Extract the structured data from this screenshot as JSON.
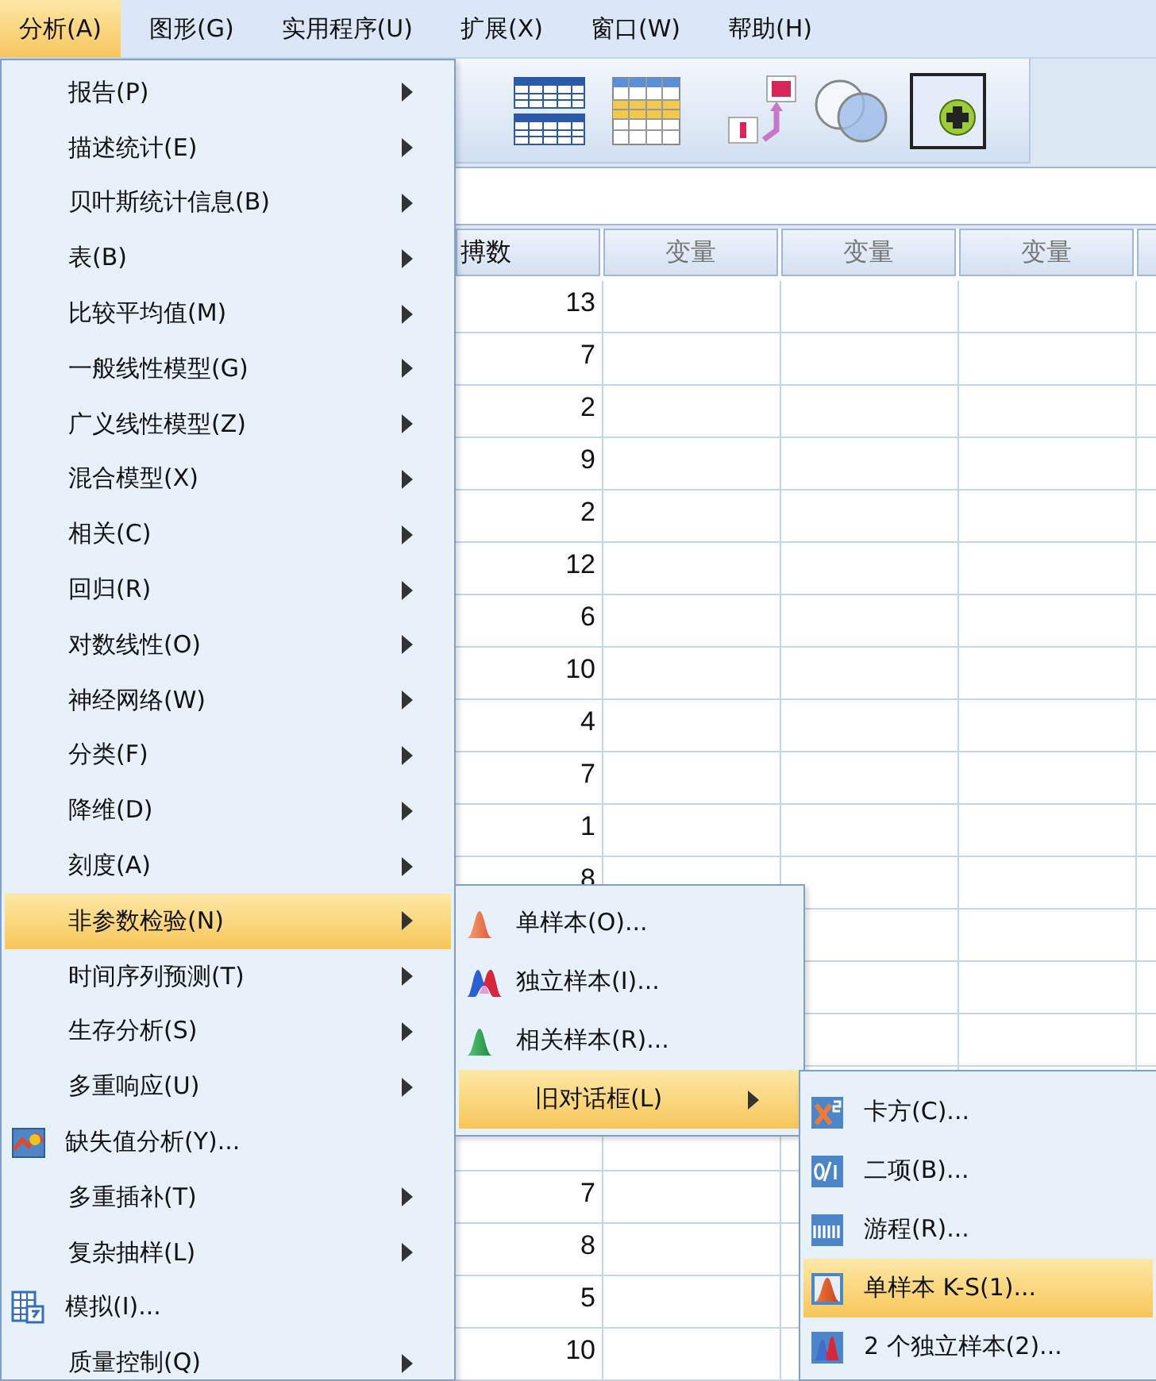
{
  "menubar": [
    {
      "label": "分析(A)",
      "selected": true
    },
    {
      "label": "图形(G)",
      "selected": false
    },
    {
      "label": "实用程序(U)",
      "selected": false
    },
    {
      "label": "扩展(X)",
      "selected": false
    },
    {
      "label": "窗口(W)",
      "selected": false
    },
    {
      "label": "帮助(H)",
      "selected": false
    }
  ],
  "grid": {
    "columns": [
      "搏数",
      "变量",
      "变量",
      "变量"
    ],
    "rows": [
      {
        "value": "13"
      },
      {
        "value": "7"
      },
      {
        "value": "2"
      },
      {
        "value": "9"
      },
      {
        "value": "2"
      },
      {
        "value": "12"
      },
      {
        "value": "6"
      },
      {
        "value": "10"
      },
      {
        "value": "4"
      },
      {
        "value": "7"
      },
      {
        "value": "1"
      },
      {
        "value": "8"
      },
      {},
      {},
      {},
      {},
      {},
      {
        "value": "7"
      },
      {
        "value": "8"
      },
      {
        "value": "5"
      },
      {
        "value": "10"
      }
    ]
  },
  "menu": {
    "items": [
      {
        "label": "报告(P)",
        "kind": "submenu",
        "selected": false
      },
      {
        "label": "描述统计(E)",
        "kind": "submenu",
        "selected": false
      },
      {
        "label": "贝叶斯统计信息(B)",
        "kind": "submenu",
        "selected": false
      },
      {
        "label": "表(B)",
        "kind": "submenu",
        "selected": false
      },
      {
        "label": "比较平均值(M)",
        "kind": "submenu",
        "selected": false
      },
      {
        "label": "一般线性模型(G)",
        "kind": "submenu",
        "selected": false
      },
      {
        "label": "广义线性模型(Z)",
        "kind": "submenu",
        "selected": false
      },
      {
        "label": "混合模型(X)",
        "kind": "submenu",
        "selected": false
      },
      {
        "label": "相关(C)",
        "kind": "submenu",
        "selected": false
      },
      {
        "label": "回归(R)",
        "kind": "submenu",
        "selected": false
      },
      {
        "label": "对数线性(O)",
        "kind": "submenu",
        "selected": false
      },
      {
        "label": "神经网络(W)",
        "kind": "submenu",
        "selected": false
      },
      {
        "label": "分类(F)",
        "kind": "submenu",
        "selected": false
      },
      {
        "label": "降维(D)",
        "kind": "submenu",
        "selected": false
      },
      {
        "label": "刻度(A)",
        "kind": "submenu",
        "selected": false
      },
      {
        "label": "非参数检验(N)",
        "kind": "submenu",
        "selected": true
      },
      {
        "label": "时间序列预测(T)",
        "kind": "submenu",
        "selected": false
      },
      {
        "label": "生存分析(S)",
        "kind": "submenu",
        "selected": false
      },
      {
        "label": "多重响应(U)",
        "kind": "submenu",
        "selected": false
      },
      {
        "label": "缺失值分析(Y)...",
        "kind": "missing",
        "selected": false
      },
      {
        "label": "多重插补(T)",
        "kind": "submenu",
        "selected": false
      },
      {
        "label": "复杂抽样(L)",
        "kind": "submenu",
        "selected": false
      },
      {
        "label": "模拟(I)...",
        "kind": "simulate",
        "selected": false
      },
      {
        "label": "质量控制(Q)",
        "kind": "submenu",
        "selected": false
      }
    ]
  },
  "nonparametric_menu": {
    "items": [
      {
        "label": "单样本(O)...",
        "kind": "one",
        "selected": false
      },
      {
        "label": "独立样本(I)...",
        "kind": "independent",
        "selected": false
      },
      {
        "label": "相关样本(R)...",
        "kind": "related",
        "selected": false
      },
      {
        "label": "旧对话框(L)",
        "kind": "submenu",
        "selected": true
      }
    ]
  },
  "legacy_menu": {
    "items": [
      {
        "label": "卡方(C)...",
        "kind": "chisquare",
        "selected": false
      },
      {
        "label": "二项(B)...",
        "kind": "binomial",
        "selected": false
      },
      {
        "label": "游程(R)...",
        "kind": "runs",
        "selected": false
      },
      {
        "label": "单样本 K-S(1)...",
        "kind": "ks",
        "selected": true
      },
      {
        "label": "2 个独立样本(2)...",
        "kind": "twoind",
        "selected": false
      }
    ]
  }
}
